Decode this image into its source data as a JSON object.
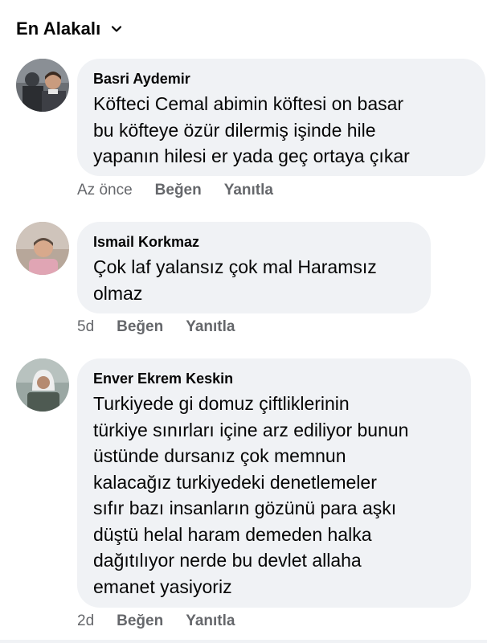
{
  "sort": {
    "label": "En Alakalı",
    "icon": "chevron-down-icon"
  },
  "comments": [
    {
      "author": "Basri Aydemir",
      "text": "Köfteci Cemal abimin köftesi on basar\nbu köfteye özür dilermiş işinde hile\nyapanın hilesi er yada geç ortaya çıkar",
      "time": "Az önce",
      "like_label": "Beğen",
      "reply_label": "Yanıtla"
    },
    {
      "author": "Ismail Korkmaz",
      "text": "Çok laf yalansız çok mal Haramsız\nolmaz",
      "time": "5d",
      "like_label": "Beğen",
      "reply_label": "Yanıtla"
    },
    {
      "author": "Enver Ekrem Keskin",
      "text": "Turkiyede gi domuz çiftliklerinin\ntürkiye sınırları içine arz ediliyor bunun\nüstünde dursanız çok memnun\nkalacağız turkiyedeki denetlemeler\nsıfır bazı insanların gözünü para aşkı\ndüştü helal haram demeden halka\ndağıtılıyor nerde bu devlet allaha\nemanet yasiyoriz",
      "time": "2d",
      "like_label": "Beğen",
      "reply_label": "Yanıtla"
    }
  ],
  "colors": {
    "bubble_bg": "#f0f2f5",
    "secondary_text": "#65676b",
    "primary_text": "#050505"
  }
}
